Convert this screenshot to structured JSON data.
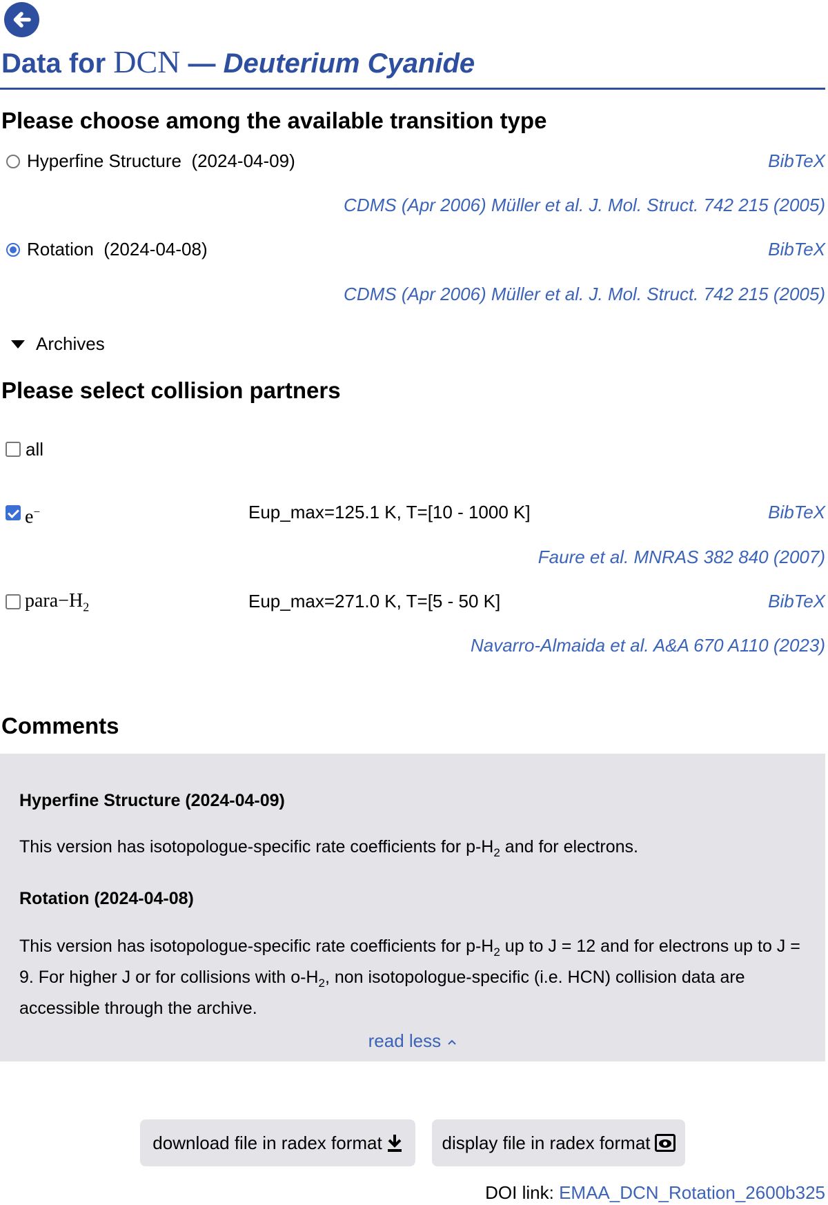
{
  "header": {
    "title_prefix": "Data for",
    "molecule_formula": "DCN",
    "dash": "—",
    "molecule_name": "Deuterium Cyanide"
  },
  "transition_section": {
    "heading": "Please choose among the available transition type",
    "options": [
      {
        "label": "Hyperfine Structure",
        "date": "(2024-04-09)",
        "selected": false,
        "bibtex": "BibTeX",
        "reference": "CDMS (Apr 2006) Müller et al. J. Mol. Struct. 742 215 (2005)"
      },
      {
        "label": "Rotation",
        "date": "(2024-04-08)",
        "selected": true,
        "bibtex": "BibTeX",
        "reference": "CDMS (Apr 2006) Müller et al. J. Mol. Struct. 742 215 (2005)"
      }
    ],
    "archives_label": "Archives"
  },
  "collision_section": {
    "heading": "Please select collision partners",
    "all_label": "all",
    "partners": [
      {
        "name": "e",
        "superscript": "−",
        "subscript": "",
        "checked": true,
        "info": "Eup_max=125.1 K, T=[10 - 1000 K]",
        "bibtex": "BibTeX",
        "reference": "Faure et al. MNRAS 382 840 (2007)"
      },
      {
        "name": "para−H",
        "superscript": "",
        "subscript": "2",
        "checked": false,
        "info": "Eup_max=271.0 K, T=[5 - 50 K]",
        "bibtex": "BibTeX",
        "reference": "Navarro-Almaida et al. A&A 670 A110 (2023)"
      }
    ]
  },
  "comments": {
    "heading": "Comments",
    "blocks": [
      {
        "title": "Hyperfine Structure (2024-04-09)",
        "text_1": "This version has isotopologue-specific rate coefficients for p-H",
        "sub_1": "2",
        "text_2": " and for electrons."
      },
      {
        "title": "Rotation (2024-04-08)",
        "text_1": "This version has isotopologue-specific rate coefficients for p-H",
        "sub_1": "2",
        "text_2": " up to J = 12 and for electrons up to J = 9. For higher J or for collisions with o-H",
        "sub_2": "2",
        "text_3": ", non isotopologue-specific (i.e. HCN) collision data are accessible through the archive."
      }
    ],
    "read_less": "read less",
    "read_less_icon": "chevron-up-icon"
  },
  "actions": {
    "download_label": "download file in radex format",
    "download_icon": "download-icon",
    "display_label": "display file in radex format",
    "display_icon": "eye-icon"
  },
  "doi": {
    "label": "DOI link:",
    "value": "EMAA_DCN_Rotation_2600b325"
  },
  "colors": {
    "accent": "#2e4fa0",
    "link": "#3b63b7",
    "panel": "#e3e3e8"
  }
}
